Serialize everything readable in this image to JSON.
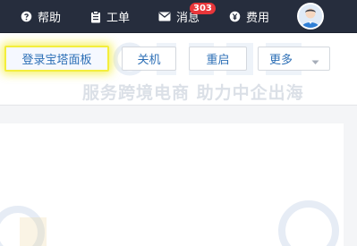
{
  "nav": {
    "help": "帮助",
    "tickets": "工单",
    "messages": "消息",
    "messages_badge": "303",
    "billing": "费用"
  },
  "toolbar": {
    "login_panel": "登录宝塔面板",
    "shutdown": "关机",
    "restart": "重启",
    "more": "更多"
  },
  "watermark": {
    "slogan": "服务跨境电商 助力中企出海"
  },
  "colors": {
    "topbar_bg": "#262d3d",
    "link_blue": "#2d6fb6",
    "badge_red": "#e8363a",
    "highlight_yellow": "#f3ee3c"
  },
  "icons": [
    "help-icon",
    "ticket-icon",
    "mail-icon",
    "billing-icon",
    "chevron-down-icon",
    "avatar"
  ]
}
